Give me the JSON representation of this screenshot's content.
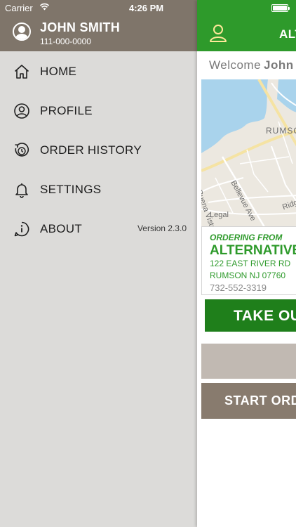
{
  "status_bar": {
    "carrier": "Carrier",
    "time": "4:26 PM"
  },
  "drawer": {
    "user": {
      "name": "JOHN SMITH",
      "phone": "111-000-0000"
    },
    "menu": [
      {
        "label": "HOME",
        "icon": "home-icon"
      },
      {
        "label": "PROFILE",
        "icon": "profile-icon"
      },
      {
        "label": "ORDER HISTORY",
        "icon": "order-history-icon"
      },
      {
        "label": "SETTINGS",
        "icon": "bell-icon"
      },
      {
        "label": "ABOUT",
        "icon": "info-icon"
      }
    ],
    "version": "Version 2.3.0"
  },
  "main": {
    "title": "ALTE",
    "welcome": "Welcome",
    "welcome_name": "John",
    "map": {
      "labels": [
        "RUMSON",
        "Bellevue Ave",
        "Buena Vista",
        "Legal",
        "Ridge"
      ]
    },
    "store": {
      "ordering_from": "ORDERING FROM",
      "name": "ALTERNATIVE",
      "address_line1": "122 EAST RIVER RD",
      "address_line2": "RUMSON NJ 07760",
      "phone": "732-552-3319"
    },
    "buttons": {
      "take_out": "TAKE OUT",
      "start_order": "START ORDER"
    }
  },
  "colors": {
    "drawer_header": "#7f756a",
    "drawer_bg": "#dcdbd9",
    "brand_green": "#2e9a2b",
    "button_green": "#1f7f1b",
    "start_button": "#887b6e",
    "gray_button": "#c1b9b2"
  }
}
